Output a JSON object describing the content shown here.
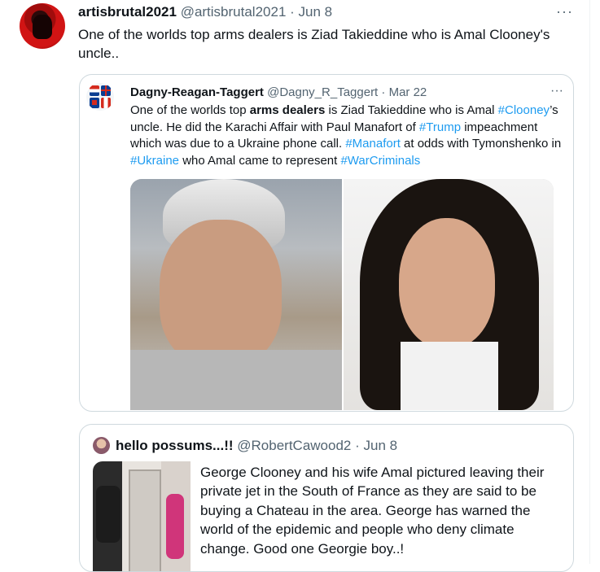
{
  "tweet": {
    "display_name": "artisbrutal2021",
    "handle": "@artisbrutal2021",
    "sep": "·",
    "date": "Jun 8",
    "more": "···",
    "text": "One of the worlds top arms dealers is Ziad Takieddine who is Amal Clooney's uncle.."
  },
  "quoted_tweet": {
    "display_name": "Dagny-Reagan-Taggert",
    "handle": "@Dagny_R_Taggert",
    "sep": "·",
    "date": "Mar 22",
    "more": "···",
    "text_parts": [
      "One of the worlds top ",
      "arms dealers",
      " is Ziad Takieddine who is Amal ",
      "#Clooney",
      "’s uncle.  He did the Karachi Affair with Paul Manafort of ",
      "#Trump",
      " impeachment which was due to a Ukraine phone call. ",
      "#Manafort",
      " at odds with Tymonshenko in ",
      "#Ukraine",
      " who Amal came to represent ",
      "#WarCriminals"
    ],
    "link_color": "#1d9bf0"
  },
  "nested_quote": {
    "display_name": "hello possums...!!",
    "handle": "@RobertCawood2",
    "sep": "·",
    "date": "Jun 8",
    "text": "George Clooney and his wife Amal pictured leaving their private jet in the South of France as they are said to be buying a Chateau in the area. George has warned the world of the epidemic and people who deny climate change. Good one Georgie boy..!"
  },
  "colors": {
    "muted": "#536471",
    "border": "#cfd9de",
    "text": "#0f1419"
  }
}
